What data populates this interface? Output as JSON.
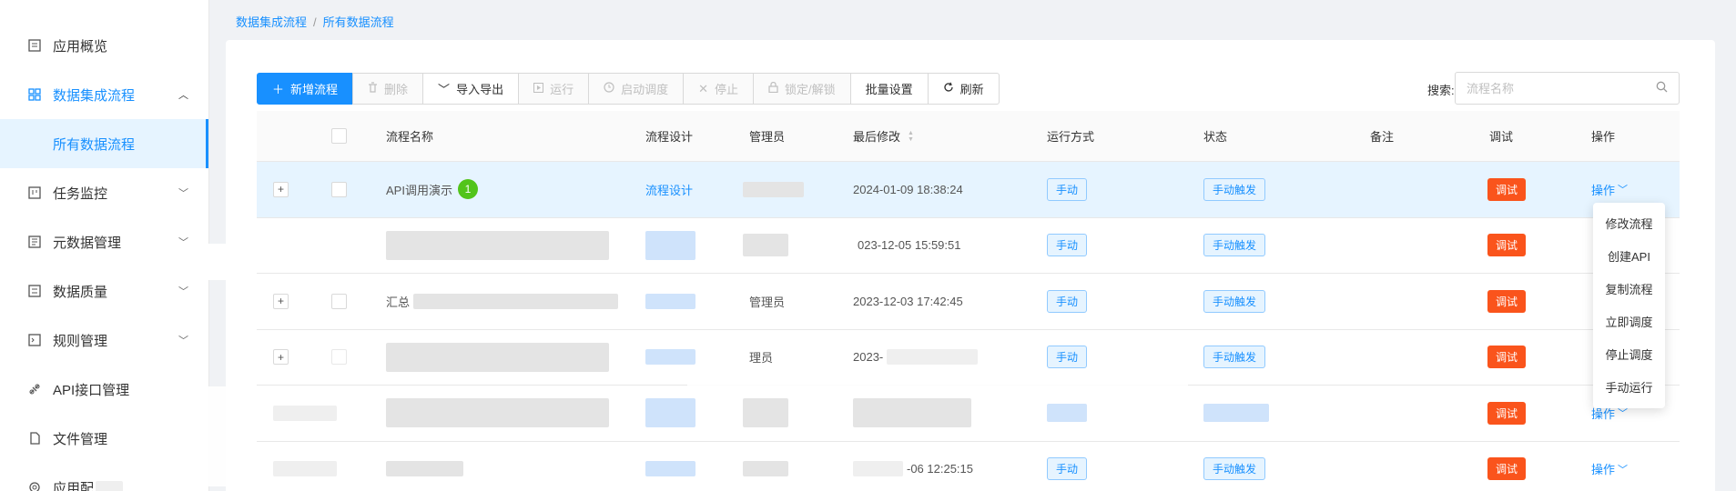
{
  "sidebar": {
    "items": [
      {
        "label": "应用概览",
        "icon": "app-overview-icon",
        "chevron": false
      },
      {
        "label": "数据集成流程",
        "icon": "grid-icon",
        "chevron": true,
        "expanded": true,
        "active": true
      },
      {
        "label": "任务监控",
        "icon": "monitor-icon",
        "chevron": true
      },
      {
        "label": "元数据管理",
        "icon": "metadata-icon",
        "chevron": true
      },
      {
        "label": "数据质量",
        "icon": "quality-icon",
        "chevron": true
      },
      {
        "label": "规则管理",
        "icon": "rule-icon",
        "chevron": true
      },
      {
        "label": "API接口管理",
        "icon": "api-icon",
        "chevron": false
      },
      {
        "label": "文件管理",
        "icon": "file-icon",
        "chevron": false
      },
      {
        "label": "应用配",
        "icon": "settings-icon",
        "chevron": false
      }
    ],
    "sub_item": "所有数据流程"
  },
  "breadcrumb": {
    "parent": "数据集成流程",
    "separator": "/",
    "current": "所有数据流程"
  },
  "toolbar": {
    "add": "新增流程",
    "delete": "删除",
    "import_export": "导入导出",
    "run": "运行",
    "start_schedule": "启动调度",
    "stop": "停止",
    "lock": "锁定/解锁",
    "batch": "批量设置",
    "refresh": "刷新"
  },
  "search": {
    "label": "搜索:",
    "placeholder": "流程名称"
  },
  "table": {
    "headers": {
      "name": "流程名称",
      "design": "流程设计",
      "admin": "管理员",
      "modified": "最后修改",
      "run_mode": "运行方式",
      "status": "状态",
      "remark": "备注",
      "debug": "调试",
      "action": "操作"
    },
    "rows": [
      {
        "name": "API调用演示",
        "badge": "1",
        "design": "流程设计",
        "modified": "2024-01-09 18:38:24",
        "run_mode": "手动",
        "status": "手动触发",
        "debug": "调试",
        "action": "操作"
      },
      {
        "name": "",
        "design": "",
        "modified": "023-12-05 15:59:51",
        "run_mode": "手动",
        "status": "手动触发",
        "debug": "调试",
        "action": ""
      },
      {
        "name": "汇总",
        "design": "",
        "admin": "管理员",
        "modified": "2023-12-03 17:42:45",
        "run_mode": "手动",
        "status": "手动触发",
        "debug": "调试",
        "action": ""
      },
      {
        "name": "",
        "design": "",
        "admin": "理员",
        "modified": "2023-",
        "run_mode": "手动",
        "status": "手动触发",
        "debug": "调试",
        "action": ""
      },
      {
        "name": "",
        "design": "",
        "modified": "",
        "run_mode": "",
        "status": "",
        "debug": "调试",
        "action": "操作"
      },
      {
        "name": "",
        "design": "",
        "modified": "-06 12:25:15",
        "run_mode": "手动",
        "status": "手动触发",
        "debug": "调试",
        "action": "操作"
      }
    ]
  },
  "dropdown": {
    "items": [
      "修改流程",
      "创建API",
      "复制流程",
      "立即调度",
      "停止调度",
      "手动运行"
    ]
  },
  "colors": {
    "primary": "#1890ff",
    "debug": "#fa541c",
    "badge": "#52c41a",
    "highlight_row": "#e6f4ff"
  }
}
